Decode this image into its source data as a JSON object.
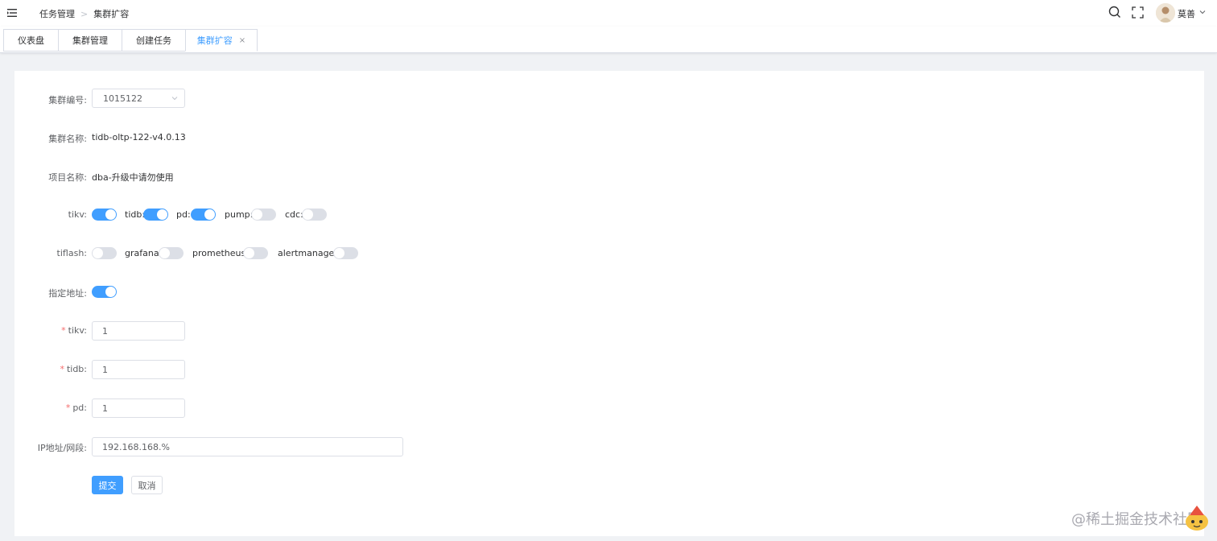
{
  "navbar": {
    "breadcrumb": [
      "任务管理",
      "集群扩容"
    ],
    "username": "莫善"
  },
  "tabs": [
    {
      "label": "仪表盘",
      "active": false
    },
    {
      "label": "集群管理",
      "active": false
    },
    {
      "label": "创建任务",
      "active": false
    },
    {
      "label": "集群扩容",
      "active": true,
      "close": "×"
    }
  ],
  "form": {
    "cluster_id_label": "集群编号:",
    "cluster_id_value": "1015122",
    "cluster_name_label": "集群名称:",
    "cluster_name_value": "tidb-oltp-122-v4.0.13",
    "project_label": "项目名称:",
    "project_value": "dba-升级中请勿使用",
    "row1": {
      "label": "tikv:",
      "switches": [
        {
          "label": "tidb:",
          "on": true
        },
        {
          "label": "pd:",
          "on": true
        },
        {
          "label": "pump:",
          "on": false
        },
        {
          "label": "cdc:",
          "on": false
        }
      ],
      "first_on": true
    },
    "row2": {
      "label": "tiflash:",
      "switches": [
        {
          "label": "grafana:",
          "on": false
        },
        {
          "label": "prometheus:",
          "on": false
        },
        {
          "label": "alertmanager:",
          "on": false
        }
      ],
      "first_on": false
    },
    "specify_addr_label": "指定地址:",
    "specify_addr_on": true,
    "required_mark": "*",
    "tikv_label": "tikv:",
    "tikv_value": "1",
    "tidb_label": "tidb:",
    "tidb_value": "1",
    "pd_label": "pd:",
    "pd_value": "1",
    "ip_label": "IP地址/网段:",
    "ip_value": "192.168.168.%",
    "submit": "提交",
    "cancel": "取消"
  },
  "watermark": "@稀土掘金技术社区",
  "colors": {
    "primary": "#409eff",
    "danger": "#f56c6c",
    "switch_off": "#dcdfe6"
  }
}
